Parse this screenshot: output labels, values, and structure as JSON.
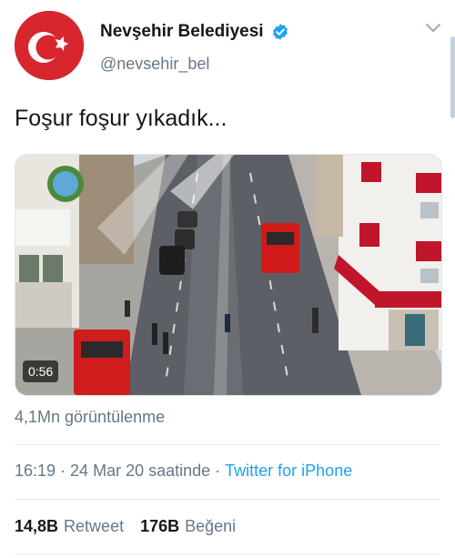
{
  "account": {
    "name": "Nevşehir Belediyesi",
    "handle": "@nevsehir_bel",
    "verified_icon": "verified-badge-icon",
    "avatar_icon": "turkish-flag-crescent-star",
    "menu_icon": "chevron-down-icon"
  },
  "tweet": {
    "text": "Foşur foşur yıkadık...",
    "video_duration": "0:56",
    "views": "4,1Mn görüntülenme"
  },
  "meta": {
    "time": "16:19",
    "separator1": "·",
    "date": "24 Mar 20 saatinde",
    "separator2": "·",
    "source": "Twitter for iPhone"
  },
  "stats": {
    "retweets_count": "14,8B",
    "retweets_label": "Retweet",
    "likes_count": "176B",
    "likes_label": "Beğeni"
  },
  "colors": {
    "accent": "#1da1f2",
    "secondary_text": "#657786",
    "flag_red": "#d7262e"
  }
}
